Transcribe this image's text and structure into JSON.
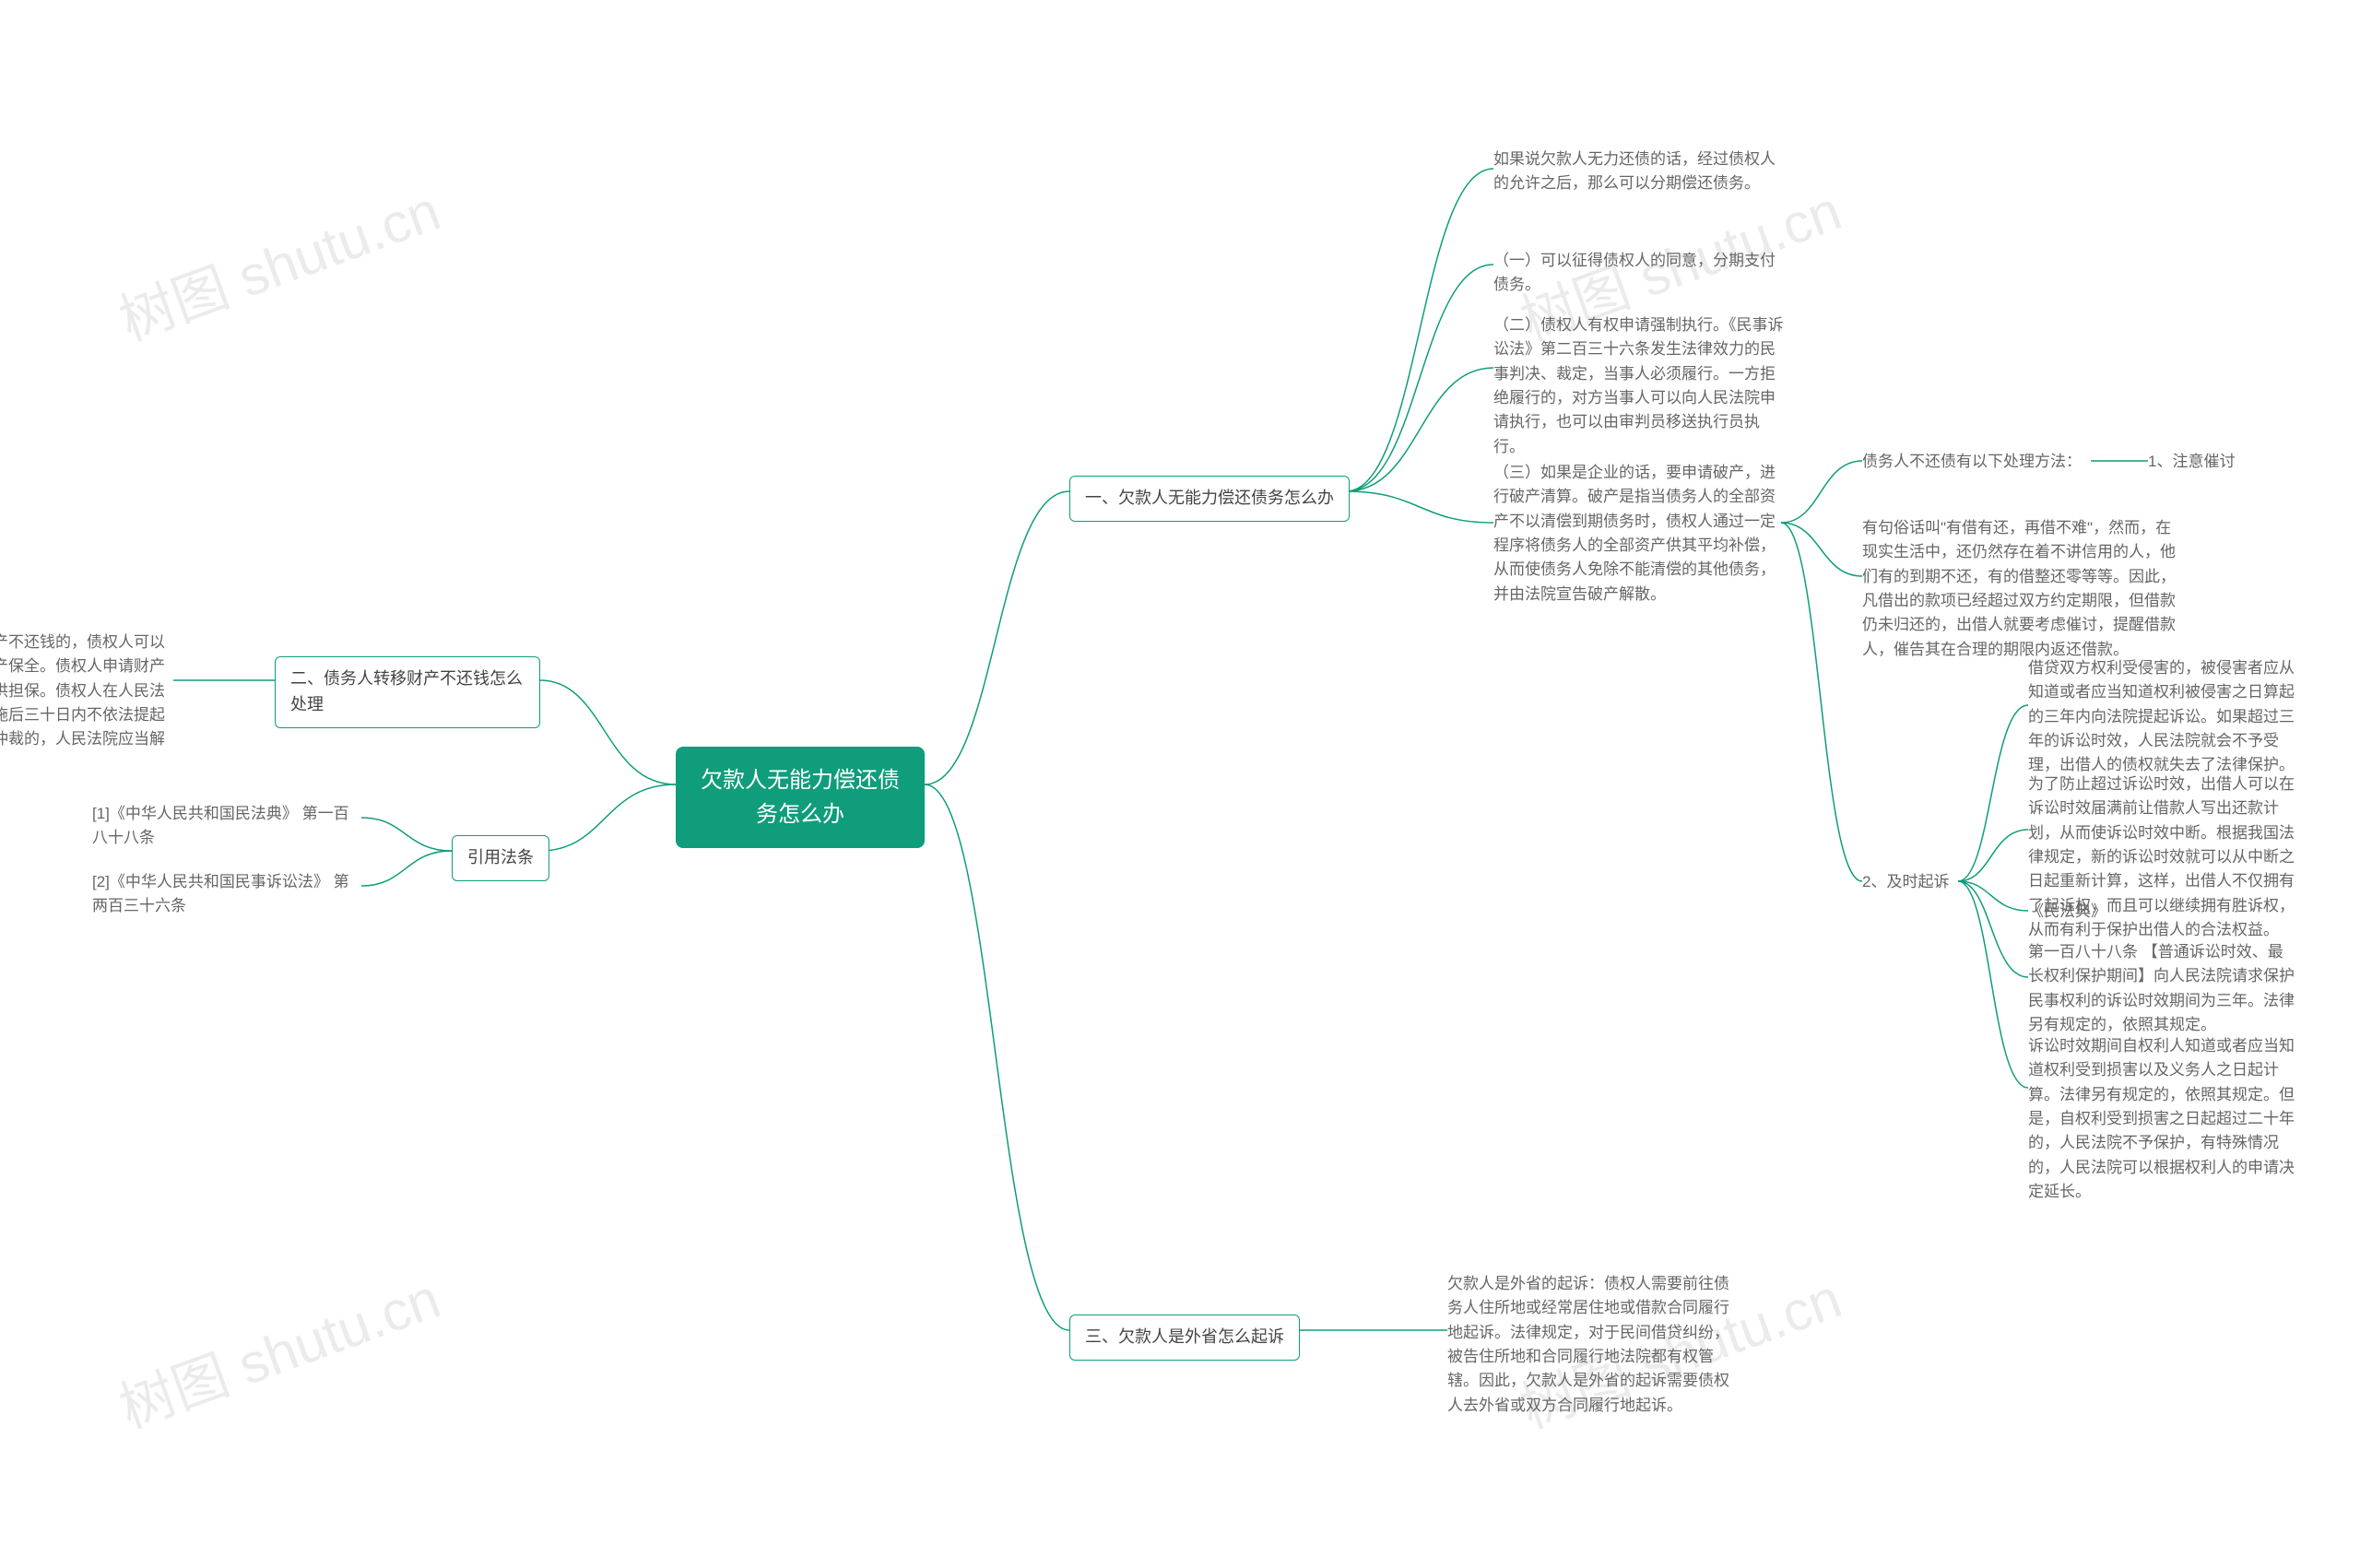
{
  "watermark": "树图 shutu.cn",
  "root": {
    "title": "欠款人无能力偿还债务怎么办"
  },
  "right": {
    "section1": {
      "title": "一、欠款人无能力偿还债务怎么办",
      "items": [
        "如果说欠款人无力还债的话，经过债权人的允许之后，那么可以分期偿还债务。",
        "（一）可以征得债权人的同意，分期支付债务。",
        "（二）债权人有权申请强制执行。《民事诉讼法》第二百三十六条发生法律效力的民事判决、裁定，当事人必须履行。一方拒绝履行的，对方当事人可以向人民法院申请执行，也可以由审判员移送执行员执行。",
        "（三）如果是企业的话，要申请破产，进行破产清算。破产是指当债务人的全部资产不以清偿到期债务时，债权人通过一定程序将债务人的全部资产供其平均补偿，从而使债务人免除不能清偿的其他债务，并由法院宣告破产解散。"
      ],
      "sub4": {
        "title": "债务人不还债有以下处理方法：",
        "m1": {
          "title": "1、注意催讨",
          "text": "有句俗话叫\"有借有还，再借不难\"，然而，在现实生活中，还仍然存在着不讲信用的人，他们有的到期不还，有的借整还零等等。因此，凡借出的款项已经超过双方约定期限，但借款仍未归还的，出借人就要考虑催讨，提醒借款人，催告其在合理的期限内返还借款。"
        },
        "m2": {
          "title": "2、及时起诉",
          "paras": [
            "借贷双方权利受侵害的，被侵害者应从知道或者应当知道权利被侵害之日算起的三年内向法院提起诉讼。如果超过三年的诉讼时效，人民法院就会不予受理，出借人的债权就失去了法律保护。",
            "为了防止超过诉讼时效，出借人可以在诉讼时效届满前让借款人写出还款计划，从而使诉讼时效中断。根据我国法律规定，新的诉讼时效就可以从中断之日起重新计算，这样，出借人不仅拥有了起诉权，而且可以继续拥有胜诉权，从而有利于保护出借人的合法权益。",
            "《民法典》",
            "第一百八十八条 【普通诉讼时效、最长权利保护期间】向人民法院请求保护民事权利的诉讼时效期间为三年。法律另有规定的，依照其规定。",
            "诉讼时效期间自权利人知道或者应当知道权利受到损害以及义务人之日起计算。法律另有规定的，依照其规定。但是，自权利受到损害之日起超过二十年的，人民法院不予保护，有特殊情况的，人民法院可以根据权利人的申请决定延长。"
          ]
        }
      }
    },
    "section3": {
      "title": "三、欠款人是外省怎么起诉",
      "text": "欠款人是外省的起诉：债权人需要前往债务人住所地或经常居住地或借款合同履行地起诉。法律规定，对于民间借贷纠纷，被告住所地和合同履行地法院都有权管辖。因此，欠款人是外省的起诉需要债权人去外省或双方合同履行地起诉。"
    }
  },
  "left": {
    "section2": {
      "title": "二、债务人转移财产不还钱怎么处理",
      "text": "债务人转移财产不还钱的，债权人可以向法院申请财产保全。债权人申请财产保全，应当提供担保。债权人在人民法院采取保全措施后三十日内不依法提起诉讼或者申请仲裁的，人民法院应当解除保全。"
    },
    "refs": {
      "title": "引用法条",
      "items": [
        "[1]《中华人民共和国民法典》 第一百八十八条",
        "[2]《中华人民共和国民事诉讼法》 第两百三十六条"
      ]
    }
  }
}
